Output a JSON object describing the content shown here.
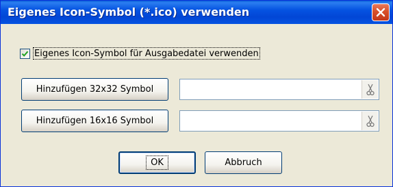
{
  "window": {
    "title": "Eigenes Icon-Symbol (*.ico) verwenden"
  },
  "checkbox": {
    "label": "Eigenes Icon-Symbol für Ausgabedatei verwenden",
    "checked": true
  },
  "icon32": {
    "button_label": "Hinzufügen 32x32 Symbol",
    "path_value": "",
    "clear_icon": "scissors-icon"
  },
  "icon16": {
    "button_label": "Hinzufügen 16x16 Symbol",
    "path_value": "",
    "clear_icon": "scissors-icon"
  },
  "buttons": {
    "ok_label": "OK",
    "cancel_label": "Abbruch"
  },
  "colors": {
    "titlebar": "#0553e1",
    "dialog_bg": "#ece9d8",
    "close_button": "#d8502a",
    "checkmark": "#21a121"
  }
}
